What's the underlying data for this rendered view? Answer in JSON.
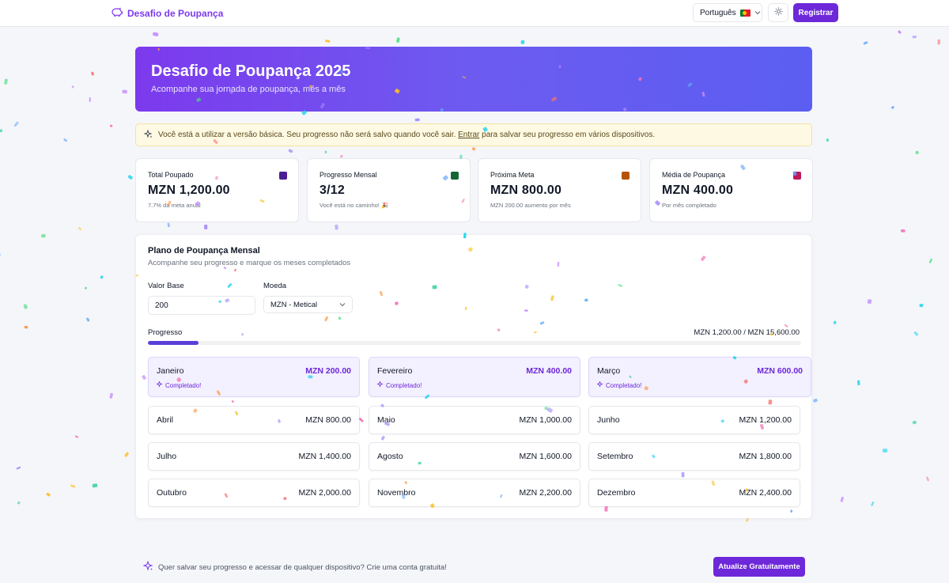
{
  "nav": {
    "brand_label": "Desafio de Poupança",
    "language_label": "Português",
    "register_label": "Registrar"
  },
  "hero": {
    "title": "Desafio de Poupança 2025",
    "subtitle": "Acompanhe sua jornada de poupança, mês a mês"
  },
  "notice": {
    "text_before": "Você está a utilizar a versão básica. Seu progresso não será salvo quando você sair. ",
    "link_label": "Entrar",
    "text_after": " para salvar seu progresso em vários dispositivos."
  },
  "stats": [
    {
      "title": "Total Poupado",
      "value": "MZN 1,200.00",
      "sub": "7.7% da meta anual",
      "icon": "piggy-bank-icon",
      "icon_color": "#4c1d95"
    },
    {
      "title": "Progresso Mensal",
      "value": "3/12",
      "sub": "Você está no caminho! 🎉",
      "icon": "trending-icon",
      "icon_color": "#166534"
    },
    {
      "title": "Próxima Meta",
      "value": "MZN 800.00",
      "sub": "MZN 200.00 aumento por mês",
      "icon": "target-icon",
      "icon_color": "#b45309"
    },
    {
      "title": "Média de Poupança",
      "value": "MZN 400.00",
      "sub": "Por mês completado",
      "icon": "chart-icon",
      "icon_color": "#be185d"
    }
  ],
  "plan": {
    "title": "Plano de Poupança Mensal",
    "subtitle": "Acompanhe seu progresso e marque os meses completados",
    "base_label": "Valor Base",
    "base_value": "200",
    "currency_label": "Moeda",
    "currency_value": "MZN - Metical",
    "progress_label": "Progresso",
    "progress_text": "MZN 1,200.00 / MZN 15,600.00",
    "progress_fraction": 0.077,
    "completed_label": "Completado!"
  },
  "months": [
    {
      "name": "Janeiro",
      "amount": "MZN 200.00",
      "done": true
    },
    {
      "name": "Fevereiro",
      "amount": "MZN 400.00",
      "done": true
    },
    {
      "name": "Março",
      "amount": "MZN 600.00",
      "done": true
    },
    {
      "name": "Abril",
      "amount": "MZN 800.00",
      "done": false
    },
    {
      "name": "Maio",
      "amount": "MZN 1,000.00",
      "done": false
    },
    {
      "name": "Junho",
      "amount": "MZN 1,200.00",
      "done": false
    },
    {
      "name": "Julho",
      "amount": "MZN 1,400.00",
      "done": false
    },
    {
      "name": "Agosto",
      "amount": "MZN 1,600.00",
      "done": false
    },
    {
      "name": "Setembro",
      "amount": "MZN 1,800.00",
      "done": false
    },
    {
      "name": "Outubro",
      "amount": "MZN 2,000.00",
      "done": false
    },
    {
      "name": "Novembro",
      "amount": "MZN 2,200.00",
      "done": false
    },
    {
      "name": "Dezembro",
      "amount": "MZN 2,400.00",
      "done": false
    }
  ],
  "footer": {
    "cta_text": "Quer salvar seu progresso e acessar de qualquer dispositivo? Crie uma conta gratuita!",
    "upgrade_label": "Atualize Gratuitamente"
  },
  "colors": {
    "accent": "#6d28d9",
    "completed_bg": "#f3f0ff",
    "notice_bg": "#fef9e3"
  }
}
